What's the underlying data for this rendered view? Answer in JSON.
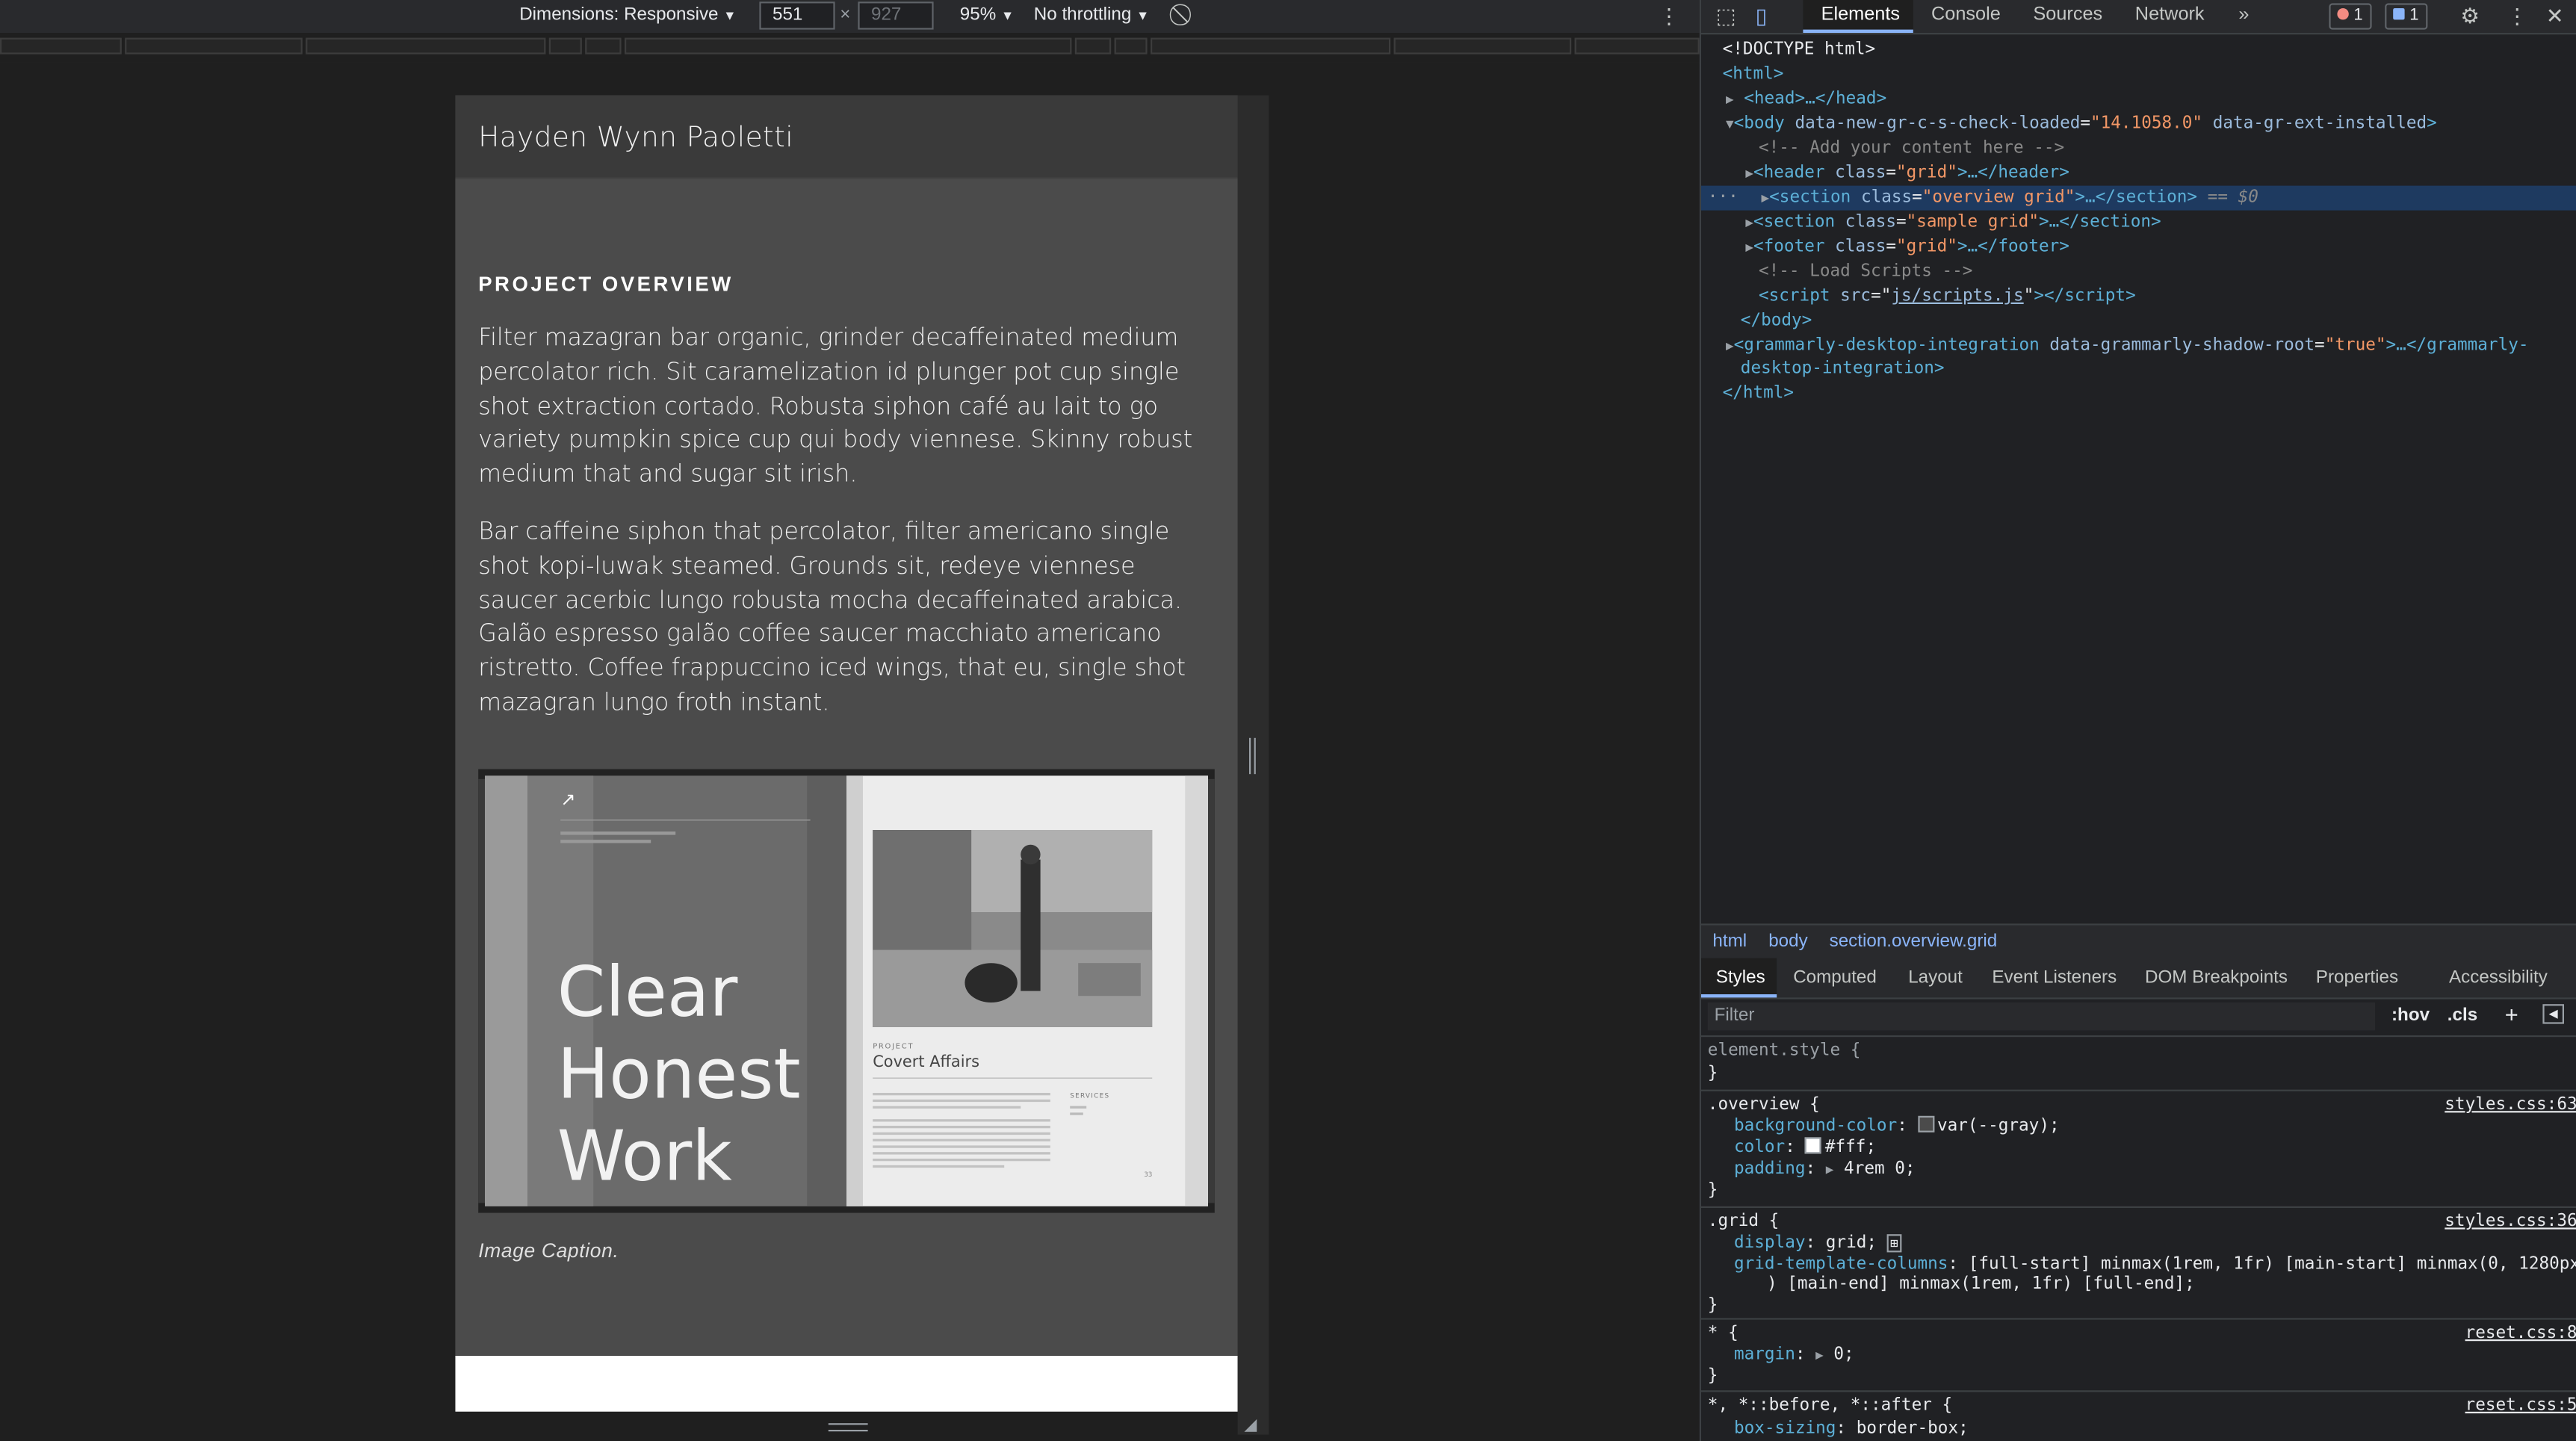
{
  "device_toolbar": {
    "dimensions_label": "Dimensions: Responsive",
    "width": "551",
    "height_placeholder": "927",
    "times": "×",
    "zoom": "95%",
    "throttling": "No throttling"
  },
  "page": {
    "site_name": "Hayden Wynn Paoletti",
    "overview_title": "PROJECT OVERVIEW",
    "para1": "Filter mazagran bar organic, grinder decaffeinated medium percolator rich. Sit caramelization id plunger pot cup single shot extraction cortado. Robusta siphon café au lait to go variety pumpkin spice cup qui body viennese. Skinny robust medium that and sugar sit irish.",
    "para2": "Bar caffeine siphon that percolator, filter americano single shot kopi-luwak steamed. Grounds sit, redeye viennese saucer acerbic lungo robusta mocha decaffeinated arabica. Galão espresso galão coffee saucer macchiato americano ristretto. Coffee frappuccino iced wings, that eu, single shot mazagran lungo froth instant.",
    "book_title_lines": [
      "Clear",
      "Honest",
      "Work"
    ],
    "book_project_label": "PROJECT",
    "book_project_name": "Covert Affairs",
    "book_services_label": "SERVICES",
    "book_page_number": "33",
    "caption": "Image Caption."
  },
  "devtools": {
    "tabs": [
      "Elements",
      "Console",
      "Sources",
      "Network"
    ],
    "more_tabs": "»",
    "error_count": "1",
    "message_count": "1",
    "colors": {
      "selected_row": "#1e3a60",
      "tag": "#5db0d7",
      "attr_value": "#f29766"
    },
    "dom": {
      "doctype": "<!DOCTYPE html>",
      "html_open": "<html>",
      "head": "<head>…</head>",
      "body_open_tag": "<body",
      "body_attr1": "data-new-gr-c-s-check-loaded",
      "body_attr1_val": "\"14.1058.0\"",
      "body_attr2": "data-gr-ext-installed",
      "comment1": "<!-- Add your content here -->",
      "header_line": "header",
      "header_class": "\"grid\"",
      "section1_class": "\"overview grid\"",
      "section_eq": "== $0",
      "section2_class": "\"sample grid\"",
      "footer_class": "\"grid\"",
      "comment2": "<!-- Load Scripts -->",
      "script_src": "js/scripts.js",
      "body_close": "</body>",
      "gram_tag": "grammarly-desktop-integration",
      "gram_attr": "data-grammarly-shadow-root",
      "gram_val": "\"true\"",
      "gram_close1": ">…</grammarly-",
      "gram_close2": "desktop-integration>",
      "html_close": "</html>",
      "gutter_dots": "···"
    },
    "breadcrumbs": [
      "html",
      "body",
      "section.overview.grid"
    ],
    "sub_tabs": [
      "Styles",
      "Computed",
      "Layout",
      "Event Listeners",
      "DOM Breakpoints",
      "Properties",
      "Accessibility"
    ],
    "filter_placeholder": "Filter",
    "hov": ":hov",
    "cls": ".cls",
    "styles": {
      "element_style": "element.style {",
      "close_brace": "}",
      "overview_selector": ".overview {",
      "overview_src": "styles.css:63",
      "bg_prop": "background-color",
      "bg_val": "var(--gray);",
      "color_prop": "color",
      "color_val": "#fff;",
      "padding_prop": "padding",
      "padding_val": "4rem 0;",
      "grid_selector": ".grid {",
      "grid_src": "styles.css:36",
      "display_prop": "display",
      "display_val": "grid;",
      "gtc_prop": "grid-template-columns",
      "gtc_val1": "[full-start] minmax(1rem, 1fr) [main-start] minmax(0, 1280px",
      "gtc_val2": ") [main-end] minmax(1rem, 1fr) [full-end];",
      "star_selector": "* {",
      "star_src": "reset.css:8",
      "margin_prop": "margin",
      "margin_val": "0;",
      "before_selector": "*, *::before, *::after {",
      "before_src": "reset.css:5",
      "boxsizing_prop": "box-sizing",
      "boxsizing_val": "border-box;"
    }
  }
}
